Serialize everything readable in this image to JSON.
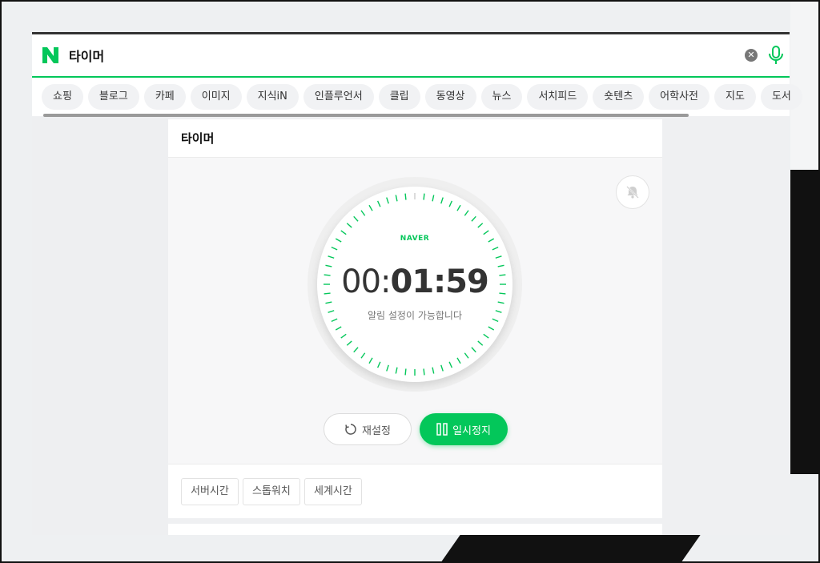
{
  "search": {
    "query": "타이머"
  },
  "tabs": [
    "쇼핑",
    "블로그",
    "카페",
    "이미지",
    "지식iN",
    "인플루언서",
    "클립",
    "동영상",
    "뉴스",
    "서치피드",
    "숏텐츠",
    "어학사전",
    "지도",
    "도서"
  ],
  "timer": {
    "title": "타이머",
    "brand": "NAVER",
    "time_hours": "00:",
    "time_minsec": "01:59",
    "hint": "알림 설정이 가능합니다",
    "reset_label": "재설정",
    "pause_label": "일시정지"
  },
  "footer": {
    "buttons": [
      "서버시간",
      "스톱워치",
      "세계시간"
    ]
  },
  "colors": {
    "accent": "#03c75a"
  },
  "icons": [
    "naver-logo-icon",
    "clear-icon",
    "mic-icon",
    "bell-off-icon",
    "reset-icon",
    "pause-icon"
  ]
}
